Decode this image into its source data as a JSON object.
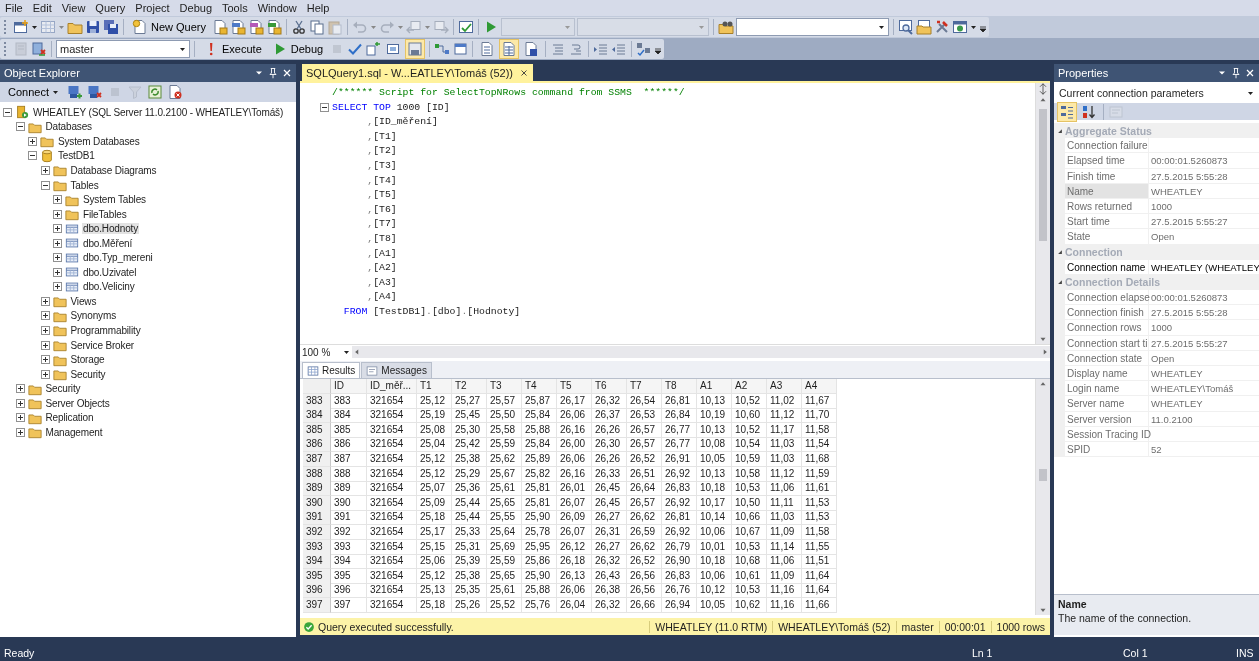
{
  "menu": [
    "File",
    "Edit",
    "View",
    "Query",
    "Project",
    "Debug",
    "Tools",
    "Window",
    "Help"
  ],
  "toolbar_standard": {
    "new_query": "New Query"
  },
  "toolbar_editor": {
    "database": "master",
    "execute": "Execute",
    "debug": "Debug",
    "query_options": [
      {
        "selected": false
      },
      {
        "selected": true
      }
    ],
    "result_modes": [
      {
        "selected": false
      },
      {
        "selected": true
      },
      {
        "selected": false
      }
    ]
  },
  "object_explorer": {
    "title": "Object Explorer",
    "connect": "Connect",
    "tree": [
      {
        "label": "WHEATLEY (SQL Server 11.0.2100 - WHEATLEY\\Tomáš)",
        "kind": "server",
        "expanded": true,
        "selected": false,
        "children": [
          {
            "label": "Databases",
            "kind": "folder",
            "expanded": true,
            "selected": false,
            "children": [
              {
                "label": "System Databases",
                "kind": "folder",
                "expanded": false,
                "selected": false
              },
              {
                "label": "TestDB1",
                "kind": "database",
                "expanded": true,
                "selected": false,
                "children": [
                  {
                    "label": "Database Diagrams",
                    "kind": "folder",
                    "expanded": false,
                    "selected": false
                  },
                  {
                    "label": "Tables",
                    "kind": "folder",
                    "expanded": true,
                    "selected": false,
                    "children": [
                      {
                        "label": "System Tables",
                        "kind": "folder",
                        "expanded": false,
                        "selected": false
                      },
                      {
                        "label": "FileTables",
                        "kind": "folder",
                        "expanded": false,
                        "selected": false
                      },
                      {
                        "label": "dbo.Hodnoty",
                        "kind": "table",
                        "expanded": false,
                        "selected": true
                      },
                      {
                        "label": "dbo.Měření",
                        "kind": "table",
                        "expanded": false,
                        "selected": false
                      },
                      {
                        "label": "dbo.Typ_mereni",
                        "kind": "table",
                        "expanded": false,
                        "selected": false
                      },
                      {
                        "label": "dbo.Uzivatel",
                        "kind": "table",
                        "expanded": false,
                        "selected": false
                      },
                      {
                        "label": "dbo.Veliciny",
                        "kind": "table",
                        "expanded": false,
                        "selected": false
                      }
                    ]
                  },
                  {
                    "label": "Views",
                    "kind": "folder",
                    "expanded": false,
                    "selected": false
                  },
                  {
                    "label": "Synonyms",
                    "kind": "folder",
                    "expanded": false,
                    "selected": false
                  },
                  {
                    "label": "Programmability",
                    "kind": "folder",
                    "expanded": false,
                    "selected": false
                  },
                  {
                    "label": "Service Broker",
                    "kind": "folder",
                    "expanded": false,
                    "selected": false
                  },
                  {
                    "label": "Storage",
                    "kind": "folder",
                    "expanded": false,
                    "selected": false
                  },
                  {
                    "label": "Security",
                    "kind": "folder",
                    "expanded": false,
                    "selected": false
                  }
                ]
              }
            ]
          },
          {
            "label": "Security",
            "kind": "folder",
            "expanded": false,
            "selected": false
          },
          {
            "label": "Server Objects",
            "kind": "folder",
            "expanded": false,
            "selected": false
          },
          {
            "label": "Replication",
            "kind": "folder",
            "expanded": false,
            "selected": false
          },
          {
            "label": "Management",
            "kind": "folder",
            "expanded": false,
            "selected": false
          }
        ]
      }
    ]
  },
  "editor": {
    "tab": {
      "title": "SQLQuery1.sql - W...EATLEY\\Tomáš (52))",
      "selected": true
    },
    "zoom": "100 %",
    "lines": [
      {
        "fold": false,
        "tokens": [
          {
            "text": "/****** Script for SelectTopNRows command from SSMS  ******/",
            "kind": "comment"
          }
        ]
      },
      {
        "fold": true,
        "tokens": [
          {
            "text": "SELECT TOP ",
            "kind": "keyword"
          },
          {
            "text": "1000 ",
            "kind": "plain"
          },
          {
            "text": "[ID]",
            "kind": "plain"
          }
        ]
      },
      {
        "fold": false,
        "tokens": [
          {
            "text": "      ,",
            "kind": "punct"
          },
          {
            "text": "[ID_měření]",
            "kind": "plain"
          }
        ]
      },
      {
        "fold": false,
        "tokens": [
          {
            "text": "      ,",
            "kind": "punct"
          },
          {
            "text": "[T1]",
            "kind": "plain"
          }
        ]
      },
      {
        "fold": false,
        "tokens": [
          {
            "text": "      ,",
            "kind": "punct"
          },
          {
            "text": "[T2]",
            "kind": "plain"
          }
        ]
      },
      {
        "fold": false,
        "tokens": [
          {
            "text": "      ,",
            "kind": "punct"
          },
          {
            "text": "[T3]",
            "kind": "plain"
          }
        ]
      },
      {
        "fold": false,
        "tokens": [
          {
            "text": "      ,",
            "kind": "punct"
          },
          {
            "text": "[T4]",
            "kind": "plain"
          }
        ]
      },
      {
        "fold": false,
        "tokens": [
          {
            "text": "      ,",
            "kind": "punct"
          },
          {
            "text": "[T5]",
            "kind": "plain"
          }
        ]
      },
      {
        "fold": false,
        "tokens": [
          {
            "text": "      ,",
            "kind": "punct"
          },
          {
            "text": "[T6]",
            "kind": "plain"
          }
        ]
      },
      {
        "fold": false,
        "tokens": [
          {
            "text": "      ,",
            "kind": "punct"
          },
          {
            "text": "[T7]",
            "kind": "plain"
          }
        ]
      },
      {
        "fold": false,
        "tokens": [
          {
            "text": "      ,",
            "kind": "punct"
          },
          {
            "text": "[T8]",
            "kind": "plain"
          }
        ]
      },
      {
        "fold": false,
        "tokens": [
          {
            "text": "      ,",
            "kind": "punct"
          },
          {
            "text": "[A1]",
            "kind": "plain"
          }
        ]
      },
      {
        "fold": false,
        "tokens": [
          {
            "text": "      ,",
            "kind": "punct"
          },
          {
            "text": "[A2]",
            "kind": "plain"
          }
        ]
      },
      {
        "fold": false,
        "tokens": [
          {
            "text": "      ,",
            "kind": "punct"
          },
          {
            "text": "[A3]",
            "kind": "plain"
          }
        ]
      },
      {
        "fold": false,
        "tokens": [
          {
            "text": "      ,",
            "kind": "punct"
          },
          {
            "text": "[A4]",
            "kind": "plain"
          }
        ]
      },
      {
        "fold": false,
        "tokens": [
          {
            "text": "  FROM ",
            "kind": "keyword"
          },
          {
            "text": "[TestDB1]",
            "kind": "plain"
          },
          {
            "text": ".",
            "kind": "punct"
          },
          {
            "text": "[dbo]",
            "kind": "plain"
          },
          {
            "text": ".",
            "kind": "punct"
          },
          {
            "text": "[Hodnoty]",
            "kind": "plain"
          }
        ]
      }
    ]
  },
  "results": {
    "tabs": [
      {
        "label": "Results",
        "kind": "grid",
        "selected": true
      },
      {
        "label": "Messages",
        "kind": "messages",
        "selected": false
      }
    ],
    "columns": [
      "ID",
      "ID_měř...",
      "T1",
      "T2",
      "T3",
      "T4",
      "T5",
      "T6",
      "T7",
      "T8",
      "A1",
      "A2",
      "A3",
      "A4"
    ],
    "rows": [
      {
        "number": "383",
        "cells": [
          "383",
          "321654",
          "25,12",
          "25,27",
          "25,57",
          "25,87",
          "26,17",
          "26,32",
          "26,54",
          "26,81",
          "10,13",
          "10,52",
          "11,02",
          "11,67"
        ]
      },
      {
        "number": "384",
        "cells": [
          "384",
          "321654",
          "25,19",
          "25,45",
          "25,50",
          "25,84",
          "26,06",
          "26,37",
          "26,53",
          "26,84",
          "10,19",
          "10,60",
          "11,12",
          "11,70"
        ]
      },
      {
        "number": "385",
        "cells": [
          "385",
          "321654",
          "25,08",
          "25,30",
          "25,58",
          "25,88",
          "26,16",
          "26,26",
          "26,57",
          "26,77",
          "10,13",
          "10,52",
          "11,17",
          "11,58"
        ]
      },
      {
        "number": "386",
        "cells": [
          "386",
          "321654",
          "25,04",
          "25,42",
          "25,59",
          "25,84",
          "26,00",
          "26,30",
          "26,57",
          "26,77",
          "10,08",
          "10,54",
          "11,03",
          "11,54"
        ]
      },
      {
        "number": "387",
        "cells": [
          "387",
          "321654",
          "25,12",
          "25,38",
          "25,62",
          "25,89",
          "26,06",
          "26,26",
          "26,52",
          "26,91",
          "10,05",
          "10,59",
          "11,03",
          "11,68"
        ]
      },
      {
        "number": "388",
        "cells": [
          "388",
          "321654",
          "25,12",
          "25,29",
          "25,67",
          "25,82",
          "26,16",
          "26,33",
          "26,51",
          "26,92",
          "10,13",
          "10,58",
          "11,12",
          "11,59"
        ]
      },
      {
        "number": "389",
        "cells": [
          "389",
          "321654",
          "25,07",
          "25,36",
          "25,61",
          "25,81",
          "26,01",
          "26,45",
          "26,64",
          "26,83",
          "10,18",
          "10,53",
          "11,06",
          "11,61"
        ]
      },
      {
        "number": "390",
        "cells": [
          "390",
          "321654",
          "25,09",
          "25,44",
          "25,65",
          "25,81",
          "26,07",
          "26,45",
          "26,57",
          "26,92",
          "10,17",
          "10,50",
          "11,11",
          "11,53"
        ]
      },
      {
        "number": "391",
        "cells": [
          "391",
          "321654",
          "25,18",
          "25,44",
          "25,55",
          "25,90",
          "26,09",
          "26,27",
          "26,62",
          "26,81",
          "10,14",
          "10,66",
          "11,03",
          "11,53"
        ]
      },
      {
        "number": "392",
        "cells": [
          "392",
          "321654",
          "25,17",
          "25,33",
          "25,64",
          "25,78",
          "26,07",
          "26,31",
          "26,59",
          "26,92",
          "10,06",
          "10,67",
          "11,09",
          "11,58"
        ]
      },
      {
        "number": "393",
        "cells": [
          "393",
          "321654",
          "25,15",
          "25,31",
          "25,69",
          "25,95",
          "26,12",
          "26,27",
          "26,62",
          "26,79",
          "10,01",
          "10,53",
          "11,14",
          "11,55"
        ]
      },
      {
        "number": "394",
        "cells": [
          "394",
          "321654",
          "25,06",
          "25,39",
          "25,59",
          "25,86",
          "26,18",
          "26,32",
          "26,52",
          "26,90",
          "10,18",
          "10,68",
          "11,06",
          "11,51"
        ]
      },
      {
        "number": "395",
        "cells": [
          "395",
          "321654",
          "25,12",
          "25,38",
          "25,65",
          "25,90",
          "26,13",
          "26,43",
          "26,56",
          "26,83",
          "10,06",
          "10,61",
          "11,09",
          "11,64"
        ]
      },
      {
        "number": "396",
        "cells": [
          "396",
          "321654",
          "25,13",
          "25,35",
          "25,61",
          "25,88",
          "26,06",
          "26,38",
          "26,56",
          "26,76",
          "10,12",
          "10,53",
          "11,16",
          "11,64"
        ]
      },
      {
        "number": "397",
        "cells": [
          "397",
          "321654",
          "25,18",
          "25,26",
          "25,52",
          "25,76",
          "26,04",
          "26,32",
          "26,66",
          "26,94",
          "10,05",
          "10,62",
          "11,16",
          "11,66"
        ]
      }
    ]
  },
  "query_status": {
    "message": "Query executed successfully.",
    "server": "WHEATLEY (11.0 RTM)",
    "login": "WHEATLEY\\Tomáš (52)",
    "database": "master",
    "elapsed": "00:00:01",
    "rows": "1000 rows"
  },
  "properties": {
    "title": "Properties",
    "object": "Current connection parameters",
    "sort_buttons": [
      {
        "kind": "categorized",
        "selected": true
      },
      {
        "kind": "alphabetical",
        "selected": false
      }
    ],
    "categories": [
      {
        "name": "Aggregate Status",
        "expanded": true,
        "rows": [
          {
            "name": "Connection failure",
            "readonly": true,
            "selected": false
          },
          {
            "name": "Elapsed time",
            "value": "00:00:01.5260873",
            "readonly": true,
            "selected": false
          },
          {
            "name": "Finish time",
            "value": "27.5.2015 5:55:28",
            "readonly": true,
            "selected": false
          },
          {
            "name": "Name",
            "value": "WHEATLEY",
            "readonly": true,
            "selected": true
          },
          {
            "name": "Rows returned",
            "value": "1000",
            "readonly": true,
            "selected": false
          },
          {
            "name": "Start time",
            "value": "27.5.2015 5:55:27",
            "readonly": true,
            "selected": false
          },
          {
            "name": "State",
            "value": "Open",
            "readonly": true,
            "selected": false
          }
        ]
      },
      {
        "name": "Connection",
        "expanded": true,
        "rows": [
          {
            "name": "Connection name",
            "value": "WHEATLEY (WHEATLEY",
            "readonly": false,
            "selected": false
          }
        ]
      },
      {
        "name": "Connection Details",
        "expanded": true,
        "rows": [
          {
            "name": "Connection elapse",
            "value": "00:00:01.5260873",
            "readonly": true,
            "selected": false
          },
          {
            "name": "Connection finish",
            "value": "27.5.2015 5:55:28",
            "readonly": true,
            "selected": false
          },
          {
            "name": "Connection rows",
            "value": "1000",
            "readonly": true,
            "selected": false
          },
          {
            "name": "Connection start ti",
            "value": "27.5.2015 5:55:27",
            "readonly": true,
            "selected": false
          },
          {
            "name": "Connection state",
            "value": "Open",
            "readonly": true,
            "selected": false
          },
          {
            "name": "Display name",
            "value": "WHEATLEY",
            "readonly": true,
            "selected": false
          },
          {
            "name": "Login name",
            "value": "WHEATLEY\\Tomáš",
            "readonly": true,
            "selected": false
          },
          {
            "name": "Server name",
            "value": "WHEATLEY",
            "readonly": true,
            "selected": false
          },
          {
            "name": "Server version",
            "value": "11.0.2100",
            "readonly": true,
            "selected": false
          },
          {
            "name": "Session Tracing ID",
            "readonly": true,
            "selected": false
          },
          {
            "name": "SPID",
            "value": "52",
            "readonly": true,
            "selected": false
          }
        ]
      }
    ],
    "description": {
      "title": "Name",
      "text": "The name of the connection."
    }
  },
  "status_bar": {
    "message": "Ready",
    "line": "Ln 1",
    "column": "Col 1",
    "mode": "INS"
  }
}
